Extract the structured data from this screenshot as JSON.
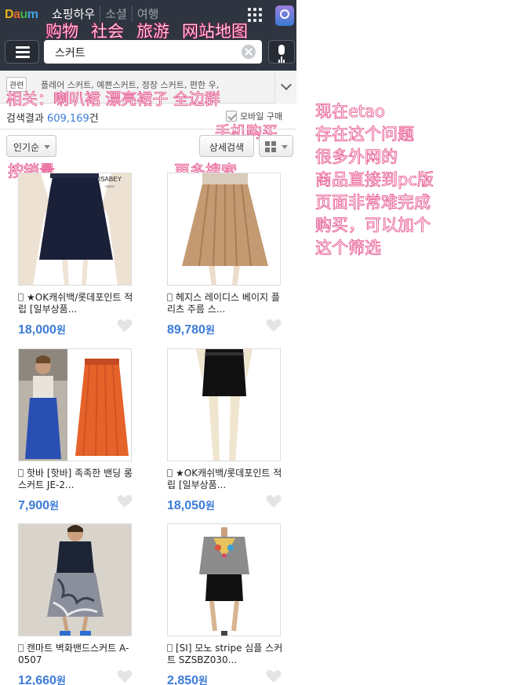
{
  "header": {
    "logo_letters": [
      "D",
      "a",
      "u",
      "m"
    ],
    "title": "쇼핑하우",
    "tabs": [
      "소셜",
      "여행"
    ]
  },
  "annotations": {
    "nav": [
      "购物",
      "社会",
      "旅游",
      "网站地图"
    ],
    "related": "相关：喇叭裙  漂亮裙子 全边群",
    "mobile": "手机购买",
    "sales": "按销量",
    "more": "更多搜索",
    "side_lines": [
      "现在etao",
      "存在这个问题",
      "很多外网的",
      "商品直接到pc版",
      "页面非常难完成",
      "购买，可以加个",
      "这个筛选"
    ]
  },
  "search": {
    "query": "스커트"
  },
  "related": {
    "tag": "관련",
    "text": "플레어 스커트, 예쁜스커트, 정장 스커트, 편한 우,"
  },
  "results": {
    "label": "검색결과",
    "count": "609,169",
    "suffix": "건",
    "mobile_filter": "모바일 구매"
  },
  "toolbar": {
    "sort_label": "인기순",
    "advanced_label": "상세검색"
  },
  "products": [
    {
      "title": "★OK캐쉬백/롯데포인트 적립 [일부상품...",
      "price": "18,000",
      "unit": "원"
    },
    {
      "title": "헤지스 레이디스 베이지 플리츠 주름 스...",
      "price": "89,780",
      "unit": "원"
    },
    {
      "title": "핫바 [핫바] 족족한 밴딩 롱스커트 JE-2...",
      "price": "7,900",
      "unit": "원"
    },
    {
      "title": "★OK캐쉬백/롯데포인트 적립 [일부상품...",
      "price": "18,050",
      "unit": "원"
    },
    {
      "title": "캔마트 벽화밴드스커트 A-0507",
      "price": "12,660",
      "unit": "원"
    },
    {
      "title": "[SI] 모노 stripe 심플 스커트 SZSBZ030...",
      "price": "2,850",
      "unit": "원"
    }
  ],
  "colors": {
    "topbar": "#2f3540",
    "price": "#3b7bd8",
    "annotation_stroke": "#e02a72"
  }
}
